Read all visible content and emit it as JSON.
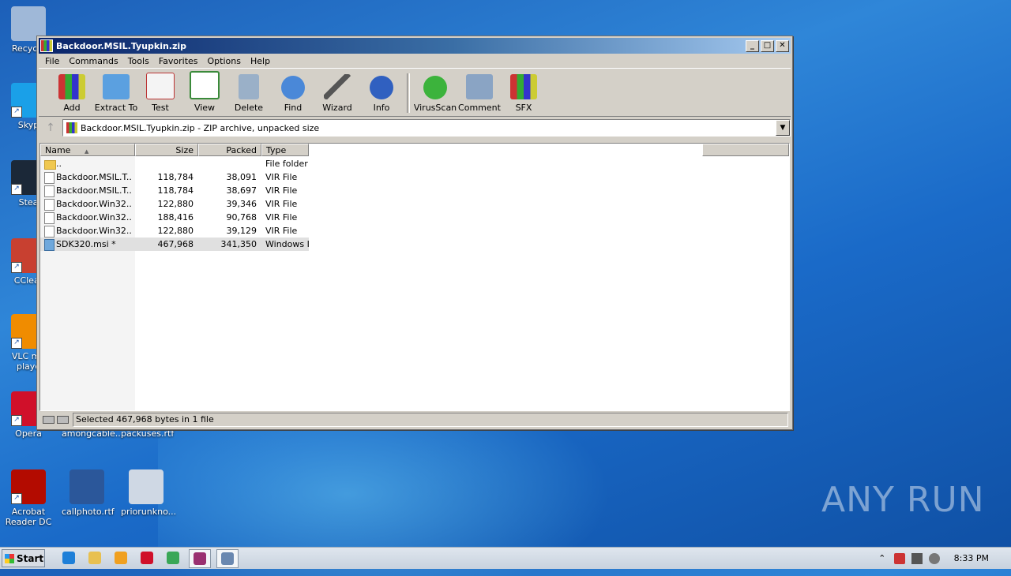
{
  "desktop": {
    "icons": [
      {
        "label": "Recycle",
        "color": "#9fb8d8"
      },
      {
        "label": "Skyp",
        "color": "#1aa0e8"
      },
      {
        "label": "Stea",
        "color": "#1b2838"
      },
      {
        "label": "CClear",
        "color": "#c84030"
      },
      {
        "label": "VLC me\nplaye",
        "color": "#f08c00"
      },
      {
        "label": "Opera",
        "color": "#d0102a"
      },
      {
        "label": "Acrobat\nReader DC",
        "color": "#b30b00"
      },
      {
        "label": "amongcable...",
        "color": "#2b579a"
      },
      {
        "label": "packuses.rtf",
        "color": "#2b579a"
      },
      {
        "label": "callphoto.rtf",
        "color": "#2b579a"
      },
      {
        "label": "priorunkno...",
        "color": "#cfd8e4"
      }
    ],
    "watermark": "ANY RUN"
  },
  "window": {
    "title": "Backdoor.MSIL.Tyupkin.zip",
    "controls": {
      "minimize": "_",
      "maximize": "□",
      "close": "✕"
    },
    "menu": [
      "File",
      "Commands",
      "Tools",
      "Favorites",
      "Options",
      "Help"
    ],
    "toolbar": [
      {
        "label": "Add",
        "icon": "add-icon"
      },
      {
        "label": "Extract To",
        "icon": "extract-icon"
      },
      {
        "label": "Test",
        "icon": "test-icon"
      },
      {
        "label": "View",
        "icon": "view-icon"
      },
      {
        "label": "Delete",
        "icon": "delete-icon"
      },
      {
        "label": "Find",
        "icon": "find-icon"
      },
      {
        "label": "Wizard",
        "icon": "wizard-icon"
      },
      {
        "label": "Info",
        "icon": "info-icon"
      },
      {
        "label": "VirusScan",
        "icon": "virusscan-icon"
      },
      {
        "label": "Comment",
        "icon": "comment-icon"
      },
      {
        "label": "SFX",
        "icon": "sfx-icon"
      }
    ],
    "address": "Backdoor.MSIL.Tyupkin.zip - ZIP archive, unpacked size",
    "up_arrow": "↑",
    "dropdown_arrow": "▼",
    "columns": {
      "name": "Name",
      "size": "Size",
      "packed": "Packed",
      "type": "Type",
      "sort_arrow": "▲"
    },
    "files": [
      {
        "name": "..",
        "size": "",
        "packed": "",
        "type": "File folder",
        "kind": "folder"
      },
      {
        "name": "Backdoor.MSIL.T...",
        "size": "118,784",
        "packed": "38,091",
        "type": "VIR File",
        "kind": "file"
      },
      {
        "name": "Backdoor.MSIL.T...",
        "size": "118,784",
        "packed": "38,697",
        "type": "VIR File",
        "kind": "file"
      },
      {
        "name": "Backdoor.Win32....",
        "size": "122,880",
        "packed": "39,346",
        "type": "VIR File",
        "kind": "file"
      },
      {
        "name": "Backdoor.Win32....",
        "size": "188,416",
        "packed": "90,768",
        "type": "VIR File",
        "kind": "file"
      },
      {
        "name": "Backdoor.Win32....",
        "size": "122,880",
        "packed": "39,129",
        "type": "VIR File",
        "kind": "file"
      },
      {
        "name": "SDK320.msi *",
        "size": "467,968",
        "packed": "341,350",
        "type": "Windows Ir",
        "kind": "msi"
      }
    ],
    "selected_index": 6,
    "status": "Selected 467,968 bytes in 1 file"
  },
  "taskbar": {
    "start_label": "Start",
    "apps": [
      {
        "name": "ie",
        "color": "#1e7fd8"
      },
      {
        "name": "explorer",
        "color": "#e8c050"
      },
      {
        "name": "media-player",
        "color": "#f0a020"
      },
      {
        "name": "opera",
        "color": "#d0102a"
      },
      {
        "name": "chrome",
        "color": "#3aa757"
      },
      {
        "name": "winrar",
        "color": "#9a3070"
      },
      {
        "name": "installer",
        "color": "#6a88b0"
      }
    ],
    "active_indices": [
      5,
      6
    ],
    "tray_up": "⌃",
    "clock": "8:33 PM"
  }
}
